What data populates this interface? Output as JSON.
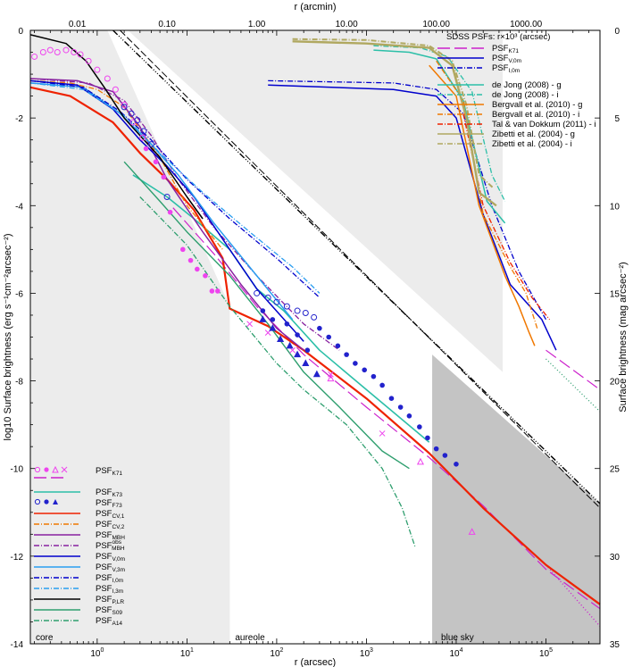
{
  "chart_data": {
    "type": "line",
    "title": "",
    "xlabel": "r (arcsec)",
    "x2label": "r (arcmin)",
    "ylabel": "log10 Surface brightness (erg s⁻¹cm⁻²arcsec⁻²)",
    "y2label": "Surface brightness (mag arcsec⁻²)",
    "xscale": "log",
    "xlim": [
      0.18,
      400000
    ],
    "ylim": [
      -14,
      0
    ],
    "x_ticks": [
      {
        "v": 1,
        "e": "0"
      },
      {
        "v": 10,
        "e": "1"
      },
      {
        "v": 100,
        "e": "2"
      },
      {
        "v": 1000,
        "e": "3"
      },
      {
        "v": 10000,
        "e": "4"
      },
      {
        "v": 100000,
        "e": "5"
      }
    ],
    "x2_ticks": [
      "0.01",
      "0.10",
      "1.00",
      "10.00",
      "100.00",
      "1000.00"
    ],
    "y_ticks": [
      "0",
      "-2",
      "-4",
      "-6",
      "-8",
      "-10",
      "-12",
      "-14"
    ],
    "y2_ticks": [
      "0",
      "5",
      "10",
      "15",
      "20",
      "25",
      "30",
      "35"
    ],
    "regions": [
      {
        "label": "core",
        "x_from": 0.18,
        "x_to": 30,
        "shade": "#ececec"
      },
      {
        "label": "aureole",
        "x_from": 30,
        "x_to": 5400,
        "shade": "none"
      },
      {
        "label": "blue sky",
        "x_from": 5400,
        "x_to": 400000,
        "shade": "#c4c4c4"
      }
    ],
    "sdss_title": "SDSS PSFs: r×10³ (arcsec)",
    "legend_left": [
      {
        "label": "PSF",
        "sub": "K71",
        "style": "markers"
      },
      {
        "label": "PSF",
        "sub": "K73",
        "color": "#2cbfa8"
      },
      {
        "label": "PSF",
        "sub": "F73",
        "style": "markers-blue"
      },
      {
        "label": "PSF",
        "sub": "CV,1",
        "color": "#ee2200"
      },
      {
        "label": "PSF",
        "sub": "CV,2",
        "color": "#f07800",
        "dash": "6,2,1,2"
      },
      {
        "label": "PSF",
        "sub": "MBH",
        "color": "#8822a0"
      },
      {
        "label": "PSF",
        "sub": "MBH",
        "sup": "obs",
        "color": "#8822a0",
        "dash": "6,2,1,2"
      },
      {
        "label": "PSF",
        "sub": "V,0m",
        "color": "#0000cc"
      },
      {
        "label": "PSF",
        "sub": "V,3m",
        "color": "#2a9ef0"
      },
      {
        "label": "PSF",
        "sub": "I,0m",
        "color": "#0000cc",
        "dash": "6,2,1,2"
      },
      {
        "label": "PSF",
        "sub": "I,3m",
        "color": "#2a9ef0",
        "dash": "6,2,1,2"
      },
      {
        "label": "PSF",
        "sub": "P,LR",
        "color": "#000000"
      },
      {
        "label": "PSF",
        "sub": "S09",
        "color": "#2e9e6e"
      },
      {
        "label": "PSF",
        "sub": "A14",
        "color": "#2e9e6e",
        "dash": "6,2,1,2"
      }
    ],
    "legend_right_psf": [
      {
        "label": "PSF",
        "sub": "K71",
        "color": "#cc22cc",
        "dash": "14,5"
      },
      {
        "label": "PSF",
        "sub": "V,0m",
        "color": "#0000cc"
      },
      {
        "label": "PSF",
        "sub": "I,0m",
        "color": "#0000cc",
        "dash": "6,2,1,2"
      }
    ],
    "legend_right_sdss": [
      {
        "label": "de Jong (2008) - g",
        "color": "#2cbfa8"
      },
      {
        "label": "de Jong (2008) - i",
        "color": "#2cbfa8",
        "dash": "6,2,1,2"
      },
      {
        "label": "Bergvall et al. (2010) - g",
        "color": "#f07800"
      },
      {
        "label": "Bergvall et al. (2010) - i",
        "color": "#f07800",
        "dash": "6,2,1,2"
      },
      {
        "label": "Tal & van Dokkum (2011) - i",
        "color": "#ee2200",
        "dash": "6,2,1,2"
      },
      {
        "label": "Zibetti et al. (2004) - g",
        "color": "#b0a860"
      },
      {
        "label": "Zibetti et al. (2004) - i",
        "color": "#b0a860",
        "dash": "6,2,1,2"
      }
    ],
    "series": [
      {
        "id": "k71",
        "color": "#cc22cc",
        "dash": "14,5",
        "width": 1.2,
        "x": [
          7,
          20,
          60,
          200,
          1000,
          5000,
          20000,
          100000,
          400000
        ],
        "y": [
          -4.05,
          -5.1,
          -6.3,
          -7.4,
          -8.6,
          -9.75,
          -10.85,
          -12.3,
          -13.2
        ]
      },
      {
        "id": "k71-ext",
        "color": "#cc22cc",
        "dash": "1,2.5",
        "width": 1.4,
        "x": [
          100000,
          400000
        ],
        "y": [
          -12.2,
          -13.6
        ]
      },
      {
        "id": "k73",
        "color": "#2cbfa8",
        "width": 1.6,
        "x": [
          2.5,
          6,
          12,
          30,
          60,
          120,
          300,
          1000,
          5000
        ],
        "y": [
          -3.3,
          -3.8,
          -4.3,
          -5.0,
          -5.9,
          -6.4,
          -7.3,
          -8.2,
          -9.4
        ]
      },
      {
        "id": "cv1",
        "color": "#ee2200",
        "width": 2.2,
        "x": [
          0.18,
          0.5,
          1.5,
          3,
          6,
          12,
          25,
          30,
          80,
          200,
          1000,
          5000,
          20000,
          100000,
          400000
        ],
        "y": [
          -1.3,
          -1.5,
          -2.1,
          -2.8,
          -3.4,
          -4.1,
          -5.2,
          -6.35,
          -6.75,
          -7.3,
          -8.4,
          -9.65,
          -10.9,
          -12.2,
          -13.1
        ]
      },
      {
        "id": "cv2",
        "color": "#f07800",
        "dash": "6,2,1,2",
        "width": 1.3,
        "x": [
          0.18,
          0.5,
          1,
          2,
          5,
          10,
          25
        ],
        "y": [
          -1.15,
          -1.2,
          -1.35,
          -1.75,
          -2.9,
          -4.0,
          -5.0
        ]
      },
      {
        "id": "mbh",
        "color": "#8822a0",
        "width": 1.5,
        "x": [
          0.18,
          0.6,
          1.5,
          3,
          6,
          15,
          40,
          100,
          200
        ],
        "y": [
          -1.1,
          -1.15,
          -1.4,
          -2.2,
          -3.4,
          -4.6,
          -5.8,
          -6.8,
          -7.3
        ]
      },
      {
        "id": "mbh-obs",
        "color": "#8822a0",
        "dash": "6,2,1,2",
        "width": 1.3,
        "x": [
          0.18,
          0.8,
          2,
          4,
          8,
          20,
          60,
          200,
          500
        ],
        "y": [
          -1.1,
          -1.2,
          -1.6,
          -2.4,
          -3.4,
          -4.5,
          -5.6,
          -6.7,
          -7.3
        ]
      },
      {
        "id": "v0m",
        "color": "#0000cc",
        "width": 1.5,
        "x": [
          0.18,
          0.6,
          1.5,
          3,
          6,
          12,
          30,
          60,
          200
        ],
        "y": [
          -1.15,
          -1.25,
          -1.8,
          -2.5,
          -3.1,
          -3.8,
          -5.0,
          -5.9,
          -7.1
        ]
      },
      {
        "id": "v3m",
        "color": "#2a9ef0",
        "width": 1.5,
        "x": [
          0.18,
          0.7,
          1.8,
          4,
          8,
          20,
          50,
          150
        ],
        "y": [
          -1.2,
          -1.3,
          -1.9,
          -2.6,
          -3.3,
          -4.4,
          -5.4,
          -6.6
        ]
      },
      {
        "id": "i0m",
        "color": "#0000cc",
        "dash": "6,2,1,2",
        "width": 1.3,
        "x": [
          0.18,
          0.7,
          1.8,
          4,
          10,
          30,
          100,
          300
        ],
        "y": [
          -1.15,
          -1.3,
          -1.85,
          -2.5,
          -3.4,
          -4.3,
          -5.2,
          -6.1
        ]
      },
      {
        "id": "i3m",
        "color": "#2a9ef0",
        "dash": "6,2,1,2",
        "width": 1.3,
        "x": [
          0.18,
          0.7,
          2,
          5,
          15,
          50,
          150,
          300
        ],
        "y": [
          -1.2,
          -1.35,
          -1.95,
          -2.8,
          -3.7,
          -4.6,
          -5.4,
          -6.0
        ]
      },
      {
        "id": "plr",
        "color": "#000000",
        "width": 1.5,
        "x": [
          0.18,
          0.45,
          0.75,
          1.2,
          2,
          3,
          5,
          10,
          15
        ],
        "y": [
          -0.1,
          -0.3,
          -0.7,
          -1.3,
          -2.0,
          -2.4,
          -2.9,
          -3.8,
          -4.3
        ]
      },
      {
        "id": "s09",
        "color": "#2e9e6e",
        "width": 1.4,
        "x": [
          2,
          5,
          10,
          30,
          80,
          200,
          500,
          1500,
          3000
        ],
        "y": [
          -3.0,
          -3.9,
          -4.6,
          -5.6,
          -6.7,
          -7.8,
          -8.6,
          -9.6,
          -10.0
        ]
      },
      {
        "id": "a14",
        "color": "#2e9e6e",
        "dash": "6,2,1,2",
        "width": 1.3,
        "x": [
          3,
          10,
          30,
          100,
          200,
          600,
          1500,
          2500,
          3500
        ],
        "y": [
          -3.8,
          -4.9,
          -6.3,
          -7.6,
          -8.2,
          -9.0,
          -10.0,
          -10.9,
          -11.8
        ]
      },
      {
        "id": "sdss-k71",
        "color": "#cc22cc",
        "dash": "14,5",
        "width": 1.2,
        "x": [
          100000,
          400000
        ],
        "y": [
          -7.3,
          -8.2
        ]
      },
      {
        "id": "sdss-k71-ext",
        "color": "#2e9e6e",
        "dash": "1,2.5",
        "width": 1.3,
        "x": [
          100000,
          400000
        ],
        "y": [
          -7.5,
          -8.7
        ]
      },
      {
        "id": "sdss-v0m",
        "color": "#0000cc",
        "width": 1.5,
        "x": [
          80,
          2000,
          6000,
          10000,
          20000,
          40000,
          90000,
          130000
        ],
        "y": [
          -1.25,
          -1.35,
          -1.5,
          -2.0,
          -4.2,
          -5.8,
          -6.6,
          -7.3
        ]
      },
      {
        "id": "sdss-i0m",
        "color": "#0000cc",
        "dash": "6,2,1,2",
        "width": 1.3,
        "x": [
          80,
          2000,
          6000,
          12000,
          25000,
          50000,
          100000
        ],
        "y": [
          -1.15,
          -1.2,
          -1.35,
          -1.9,
          -4.0,
          -5.5,
          -6.6
        ]
      },
      {
        "id": "dejong-g",
        "color": "#2cbfa8",
        "width": 1.5,
        "x": [
          1200,
          3000,
          6000,
          12000,
          22000,
          35000
        ],
        "y": [
          -0.45,
          -0.5,
          -0.65,
          -1.6,
          -3.9,
          -4.4
        ]
      },
      {
        "id": "dejong-i",
        "color": "#2cbfa8",
        "dash": "6,2,1,2",
        "width": 1.3,
        "x": [
          1200,
          4000,
          8000,
          15000,
          25000,
          35000
        ],
        "y": [
          -0.35,
          -0.4,
          -0.6,
          -1.4,
          -3.3,
          -3.9
        ]
      },
      {
        "id": "bergvall-g",
        "color": "#f07800",
        "width": 1.5,
        "x": [
          5000,
          10000,
          18000,
          35000,
          50000,
          65000,
          75000
        ],
        "y": [
          -0.8,
          -1.5,
          -4.0,
          -5.6,
          -6.3,
          -6.9,
          -7.2
        ]
      },
      {
        "id": "bergvall-i",
        "color": "#f07800",
        "dash": "6,2,1,2",
        "width": 1.3,
        "x": [
          6000,
          12000,
          20000,
          40000,
          60000,
          80000
        ],
        "y": [
          -0.7,
          -1.6,
          -4.2,
          -5.4,
          -6.0,
          -6.8
        ]
      },
      {
        "id": "tal-i",
        "color": "#ee2200",
        "dash": "6,2,1,2",
        "width": 1.3,
        "x": [
          12000,
          20000,
          40000,
          70000,
          110000
        ],
        "y": [
          -1.9,
          -4.0,
          -5.3,
          -6.1,
          -6.6
        ]
      },
      {
        "id": "zibetti-g",
        "color": "#b0a860",
        "width": 2.4,
        "x": [
          150,
          1000,
          5000,
          9000,
          13000,
          18000,
          28000
        ],
        "y": [
          -0.25,
          -0.3,
          -0.4,
          -0.8,
          -2.0,
          -3.7,
          -4.0
        ]
      },
      {
        "id": "zibetti-i",
        "color": "#b0a860",
        "dash": "6,2,1,2",
        "width": 2.0,
        "x": [
          150,
          1000,
          5000,
          9000,
          13000,
          18000,
          26000
        ],
        "y": [
          -0.2,
          -0.22,
          -0.35,
          -0.7,
          -1.7,
          -3.3,
          -3.6
        ]
      }
    ],
    "sky_lines": [
      {
        "id": "sky-1",
        "color": "#000000",
        "dash": "7,2,1,2,1,2,1,2",
        "width": 1.4,
        "x": [
          1.5,
          400000
        ],
        "y": [
          0,
          -10.8
        ]
      },
      {
        "id": "sky-2",
        "color": "#000000",
        "dash": "8,3",
        "width": 1.0,
        "x": [
          1.8,
          400000
        ],
        "y": [
          0,
          -10.9
        ]
      }
    ],
    "markers": [
      {
        "id": "k71-open-circle",
        "shape": "open-circle",
        "color": "#ee44ee",
        "x": [
          0.2,
          0.25,
          0.3,
          0.36,
          0.45,
          0.55,
          0.65,
          0.8,
          1.0,
          1.3,
          1.6,
          2.0,
          2.5,
          3.2
        ],
        "y": [
          -0.6,
          -0.5,
          -0.45,
          -0.5,
          -0.45,
          -0.5,
          -0.55,
          -0.7,
          -0.9,
          -1.1,
          -1.35,
          -1.7,
          -2.1,
          -2.45
        ]
      },
      {
        "id": "k71-filled-circle",
        "shape": "filled-circle",
        "color": "#ee44ee",
        "x": [
          3.5,
          4.5,
          5.5,
          6.5,
          9,
          11,
          13,
          16,
          19,
          22
        ],
        "y": [
          -2.7,
          -3.0,
          -3.35,
          -4.15,
          -5.0,
          -5.25,
          -5.45,
          -5.6,
          -5.95,
          -5.95
        ]
      },
      {
        "id": "k71-open-triangle",
        "shape": "open-triangle",
        "color": "#ee44ee",
        "x": [
          400,
          4000,
          15000
        ],
        "y": [
          -7.95,
          -9.85,
          -11.45
        ]
      },
      {
        "id": "k71-cross",
        "shape": "cross",
        "color": "#ee44ee",
        "x": [
          50,
          80,
          150,
          400,
          1500
        ],
        "y": [
          -6.7,
          -6.9,
          -7.3,
          -7.85,
          -9.2
        ]
      },
      {
        "id": "f73-open-circle",
        "shape": "open-circle",
        "color": "#2222cc",
        "x": [
          2,
          2.4,
          2.8,
          3.3,
          4,
          6,
          60,
          80,
          100,
          130,
          170,
          210,
          260
        ],
        "y": [
          -1.75,
          -1.9,
          -2.05,
          -2.3,
          -2.6,
          -3.8,
          -6.0,
          -6.1,
          -6.2,
          -6.3,
          -6.4,
          -6.45,
          -6.55
        ]
      },
      {
        "id": "f73-filled-circle",
        "shape": "filled-circle",
        "color": "#2222cc",
        "x": [
          70,
          90,
          130,
          170,
          220,
          300,
          380,
          480,
          600,
          750,
          950,
          1200,
          1500,
          1900,
          2400,
          3000,
          3900,
          4800,
          6000,
          7500,
          10000
        ],
        "y": [
          -6.4,
          -6.6,
          -6.7,
          -6.95,
          -7.3,
          -6.8,
          -7.0,
          -7.2,
          -7.4,
          -7.6,
          -7.75,
          -7.9,
          -8.1,
          -8.4,
          -8.6,
          -8.8,
          -9.05,
          -9.3,
          -9.55,
          -9.7,
          -9.9
        ]
      },
      {
        "id": "f73-filled-triangle",
        "shape": "filled-triangle",
        "color": "#2222cc",
        "x": [
          70,
          90,
          110,
          140,
          170,
          210,
          280
        ],
        "y": [
          -6.6,
          -6.8,
          -7.05,
          -7.2,
          -7.4,
          -7.6,
          -7.85
        ]
      }
    ],
    "colors": {
      "background": "#ffffff",
      "axis": "#000000",
      "shade_core": "#ececec",
      "shade_sky": "#c4c4c4"
    }
  }
}
